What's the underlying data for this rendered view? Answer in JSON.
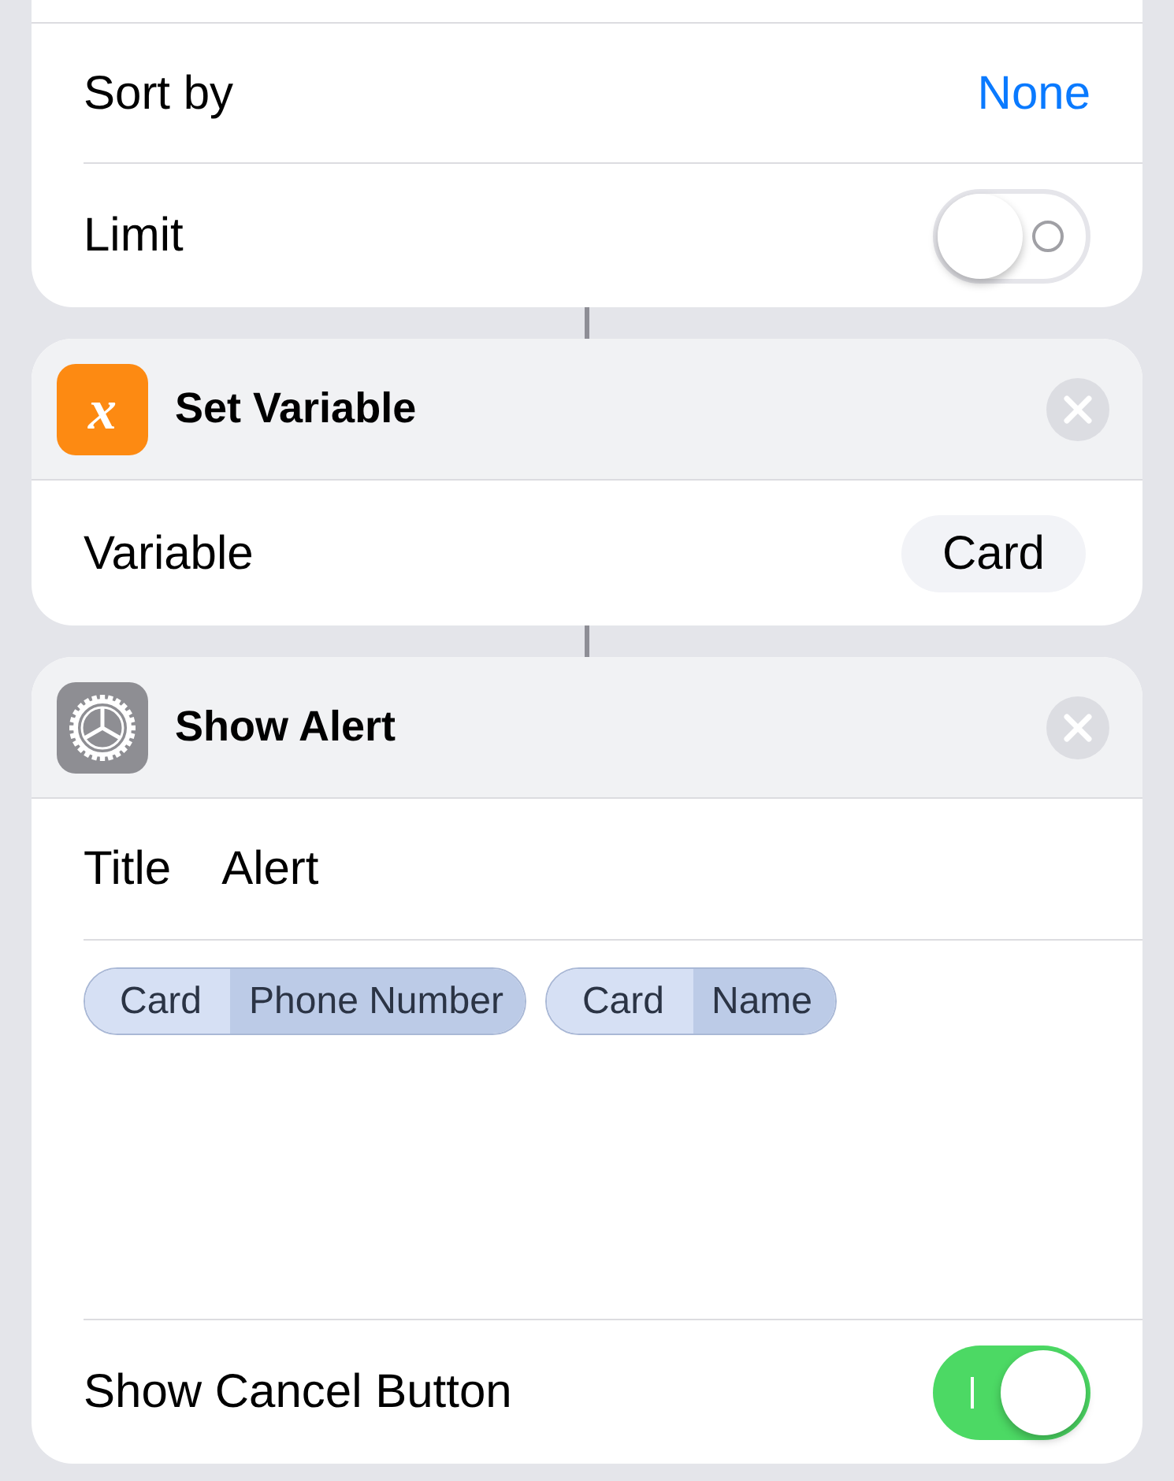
{
  "top_card": {
    "rows": [
      {
        "kind": "value",
        "label": "Sort by",
        "value": "None"
      },
      {
        "kind": "toggle",
        "label": "Limit",
        "on": false
      }
    ]
  },
  "actions": [
    {
      "kind": "glyph",
      "glyph": "x",
      "title": "Set Variable",
      "rows": [
        {
          "kind": "token",
          "label": "Variable",
          "value": "Card"
        }
      ]
    },
    {
      "kind": "gear",
      "title": "Show Alert",
      "rows": [
        {
          "kind": "text",
          "label": "Title",
          "value": "Alert"
        },
        {
          "kind": "tokens",
          "tokens": [
            {
              "variable": "Card",
              "property": "Phone Number"
            },
            {
              "variable": "Card",
              "property": "Name"
            }
          ]
        },
        {
          "kind": "toggle",
          "label": "Show Cancel Button",
          "on": true
        }
      ]
    }
  ]
}
